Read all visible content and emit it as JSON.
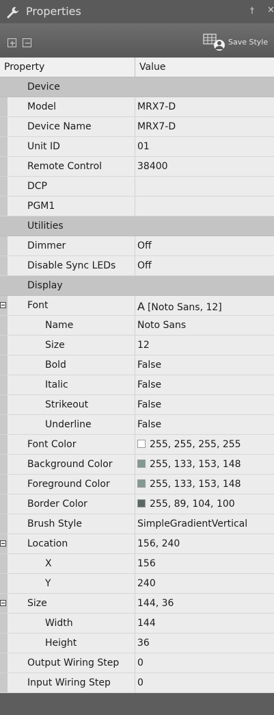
{
  "panel": {
    "title": "Properties",
    "pin_glyph": "📌",
    "close_glyph": "×",
    "save_style_label": "Save Style"
  },
  "headers": {
    "property": "Property",
    "value": "Value"
  },
  "rows": [
    {
      "type": "category",
      "label": "Device"
    },
    {
      "level": 1,
      "label": "Model",
      "value": "MRX7-D"
    },
    {
      "level": 1,
      "label": "Device Name",
      "value": "MRX7-D"
    },
    {
      "level": 1,
      "label": "Unit ID",
      "value": "01"
    },
    {
      "level": 1,
      "label": "Remote Control",
      "value": "38400"
    },
    {
      "level": 1,
      "label": "DCP",
      "value": ""
    },
    {
      "level": 1,
      "label": "PGM1",
      "value": ""
    },
    {
      "type": "category",
      "label": "Utilities"
    },
    {
      "level": 1,
      "label": "Dimmer",
      "value": "Off"
    },
    {
      "level": 1,
      "label": "Disable Sync LEDs",
      "value": "Off"
    },
    {
      "type": "category",
      "label": "Display"
    },
    {
      "level": 0,
      "expandable": true,
      "label": "Font",
      "value": "[Noto Sans, 12]",
      "font_glyph": "A"
    },
    {
      "level": 2,
      "label": "Name",
      "value": "Noto Sans"
    },
    {
      "level": 2,
      "label": "Size",
      "value": "12"
    },
    {
      "level": 2,
      "label": "Bold",
      "value": "False"
    },
    {
      "level": 2,
      "label": "Italic",
      "value": "False"
    },
    {
      "level": 2,
      "label": "Strikeout",
      "value": "False"
    },
    {
      "level": 2,
      "label": "Underline",
      "value": "False"
    },
    {
      "level": 1,
      "label": "Font Color",
      "value": "255, 255, 255, 255",
      "swatch": "#ffffff"
    },
    {
      "level": 1,
      "label": "Background Color",
      "value": "255, 133, 153, 148",
      "swatch": "#859994"
    },
    {
      "level": 1,
      "label": "Foreground Color",
      "value": "255, 133, 153, 148",
      "swatch": "#859994"
    },
    {
      "level": 1,
      "label": "Border Color",
      "value": "255, 89, 104, 100",
      "swatch": "#596864"
    },
    {
      "level": 1,
      "label": "Brush Style",
      "value": "SimpleGradientVertical"
    },
    {
      "level": 0,
      "expandable": true,
      "label": "Location",
      "value": "156, 240"
    },
    {
      "level": 2,
      "label": "X",
      "value": "156"
    },
    {
      "level": 2,
      "label": "Y",
      "value": "240"
    },
    {
      "level": 0,
      "expandable": true,
      "label": "Size",
      "value": "144, 36"
    },
    {
      "level": 2,
      "label": "Width",
      "value": "144"
    },
    {
      "level": 2,
      "label": "Height",
      "value": "36"
    },
    {
      "level": 1,
      "label": "Output Wiring Step",
      "value": "0"
    },
    {
      "level": 1,
      "label": "Input Wiring Step",
      "value": "0"
    }
  ]
}
